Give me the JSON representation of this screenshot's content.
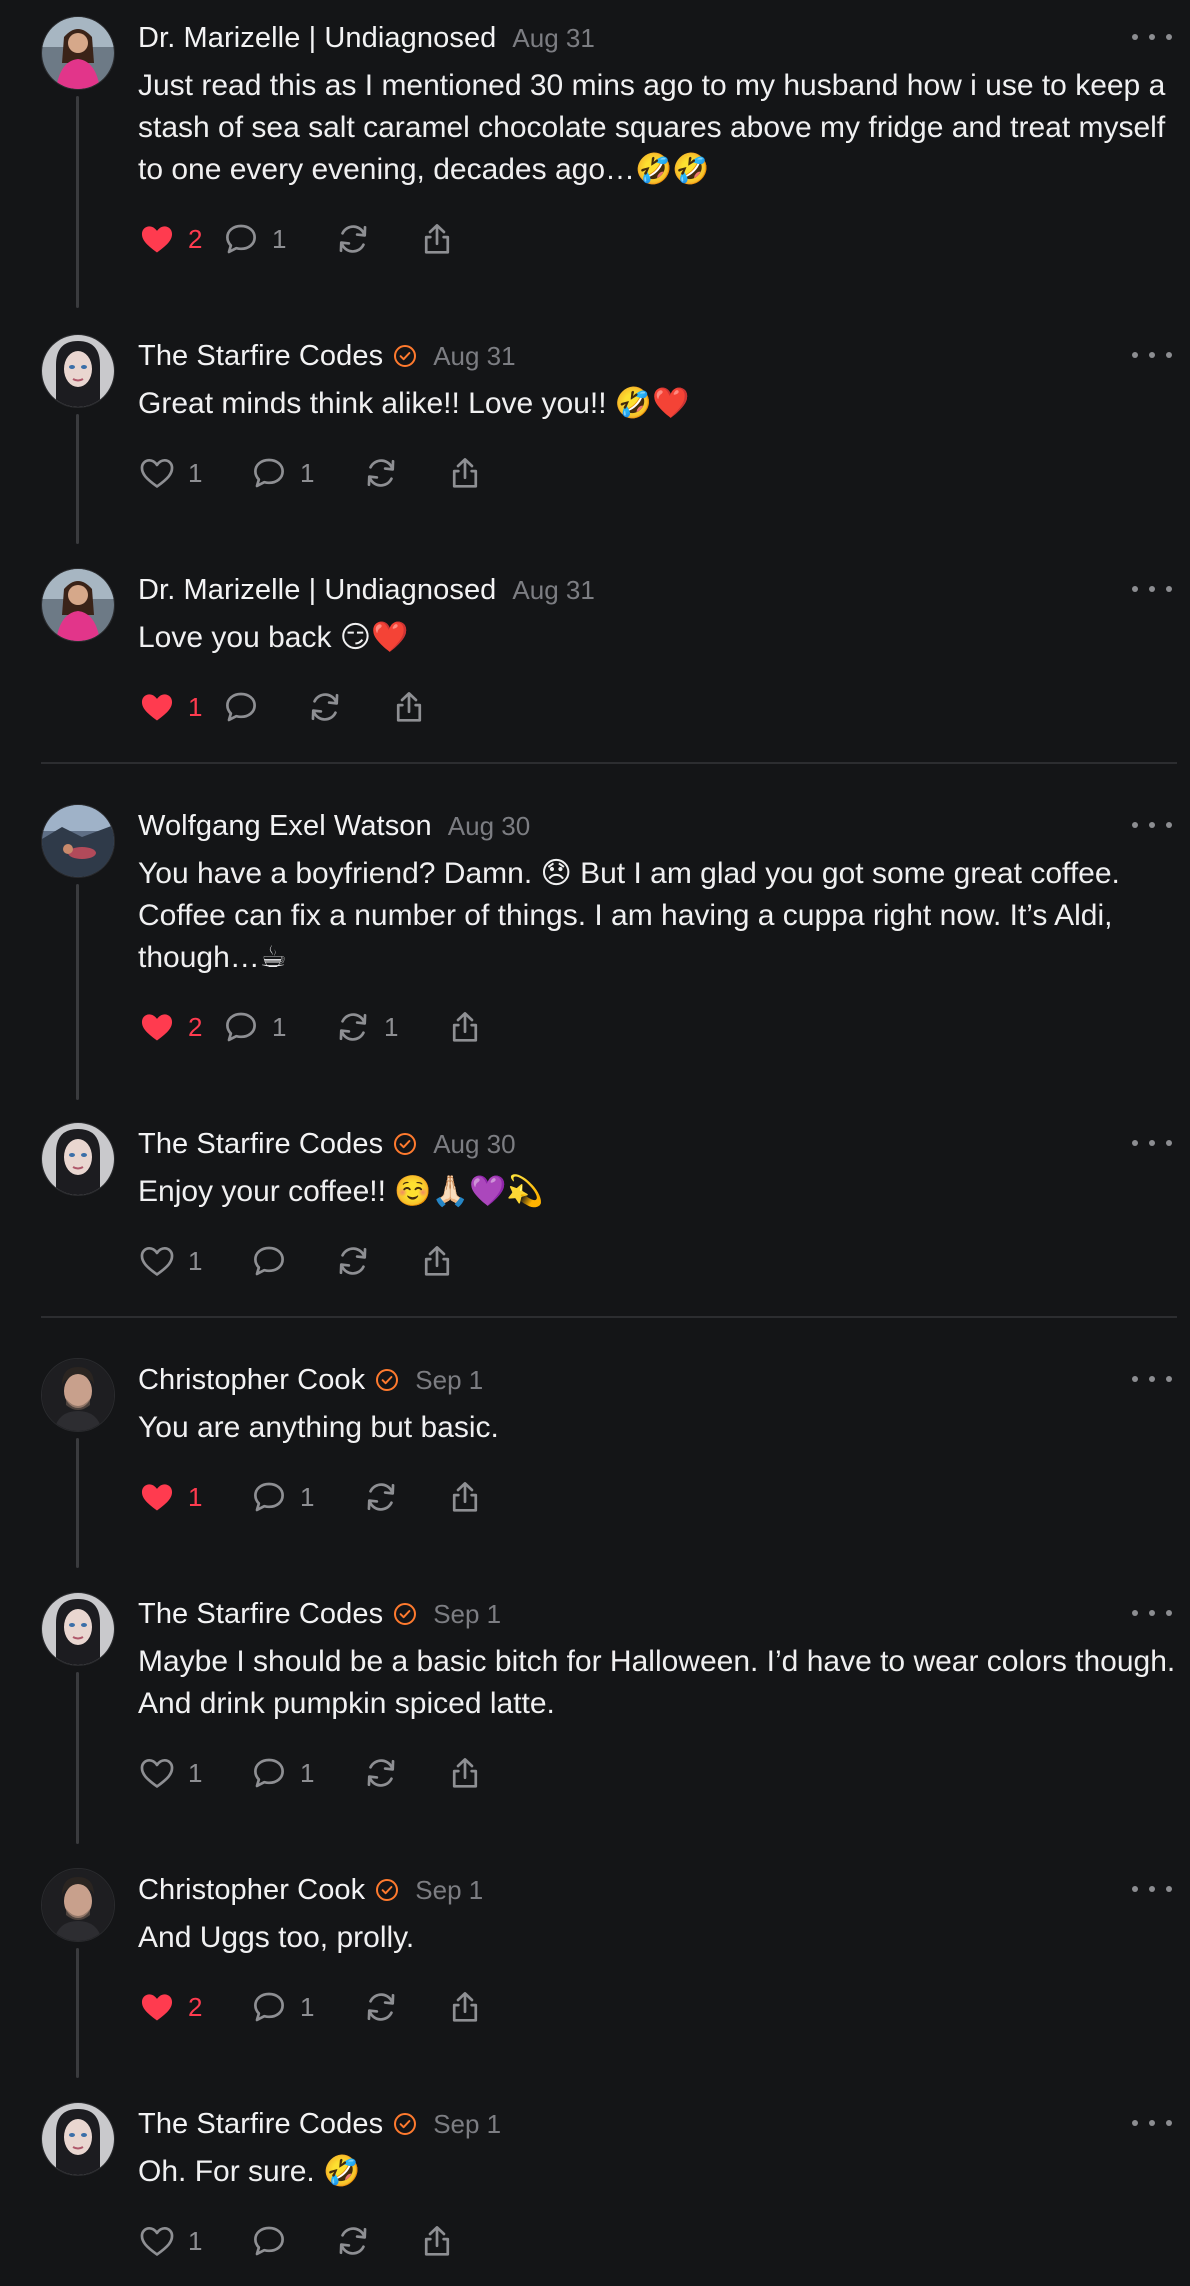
{
  "colors": {
    "background": "#141517",
    "liked": "#ff3b4f",
    "verified": "#ff7a2e",
    "muted": "#7c7d82"
  },
  "posts": [
    {
      "author": "Dr. Marizelle | Undiagnosed",
      "verified": false,
      "date": "Aug 31",
      "avatar": "avatar-woman-pink-dress",
      "text": "Just read this as I mentioned 30 mins ago to my husband how i use to keep a stash of sea salt caramel chocolate squares above my fridge and treat myself to one every evening, decades ago…🤣🤣",
      "liked": true,
      "likes": "2",
      "replies": "1",
      "reposts": ""
    },
    {
      "author": "The Starfire Codes",
      "verified": true,
      "date": "Aug 31",
      "avatar": "avatar-woman-dark-hair",
      "text": "Great minds think alike!! Love you!! 🤣❤️",
      "liked": false,
      "likes": "1",
      "replies": "1",
      "reposts": ""
    },
    {
      "author": "Dr. Marizelle | Undiagnosed",
      "verified": false,
      "date": "Aug 31",
      "avatar": "avatar-woman-pink-dress",
      "text": "Love you back 😏❤️",
      "liked": true,
      "likes": "1",
      "replies": "",
      "reposts": ""
    },
    {
      "author": "Wolfgang Exel Watson",
      "verified": false,
      "date": "Aug 30",
      "avatar": "avatar-landscape",
      "text": "You have a boyfriend? Damn. 😞 But I am glad you got some great coffee. Coffee can fix a number of things. I am having a cuppa right now. It’s Aldi, though…☕",
      "liked": true,
      "likes": "2",
      "replies": "1",
      "reposts": "1"
    },
    {
      "author": "The Starfire Codes",
      "verified": true,
      "date": "Aug 30",
      "avatar": "avatar-woman-dark-hair",
      "text": "Enjoy your coffee!! ☺️🙏🏻💜💫",
      "liked": false,
      "likes": "1",
      "replies": "",
      "reposts": ""
    },
    {
      "author": "Christopher Cook",
      "verified": true,
      "date": "Sep 1",
      "avatar": "avatar-man-portrait",
      "text": "You are anything but basic.",
      "liked": true,
      "likes": "1",
      "replies": "1",
      "reposts": ""
    },
    {
      "author": "The Starfire Codes",
      "verified": true,
      "date": "Sep 1",
      "avatar": "avatar-woman-dark-hair",
      "text": "Maybe I should be a basic bitch for Halloween. I’d have to wear colors though. And drink pumpkin spiced latte.",
      "liked": false,
      "likes": "1",
      "replies": "1",
      "reposts": ""
    },
    {
      "author": "Christopher Cook",
      "verified": true,
      "date": "Sep 1",
      "avatar": "avatar-man-portrait",
      "text": "And Uggs too, prolly.",
      "liked": true,
      "likes": "2",
      "replies": "1",
      "reposts": ""
    },
    {
      "author": "The Starfire Codes",
      "verified": true,
      "date": "Sep 1",
      "avatar": "avatar-woman-dark-hair",
      "text": "Oh. For sure. 🤣",
      "liked": false,
      "likes": "1",
      "replies": "",
      "reposts": ""
    }
  ]
}
